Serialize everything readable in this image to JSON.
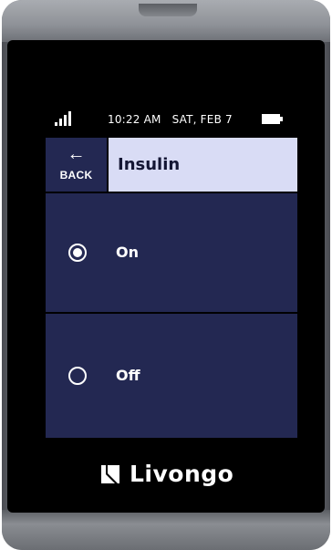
{
  "status_bar": {
    "time_date": "10:22 AM   SAT, FEB 7",
    "signal_icon": "signal-strength-icon",
    "battery_icon": "battery-icon",
    "battery_level": 0.8
  },
  "header": {
    "back_icon": "back-arrow-icon",
    "back_label": "BACK",
    "title": "Insulin"
  },
  "options": [
    {
      "label": "On",
      "selected": true
    },
    {
      "label": "Off",
      "selected": false
    }
  ],
  "brand": {
    "logo_icon": "livongo-logo-icon",
    "name": "Livongo"
  },
  "colors": {
    "panel": "#232852",
    "title_bar": "#d9dcf5",
    "screen": "#000000",
    "text": "#ffffff"
  }
}
